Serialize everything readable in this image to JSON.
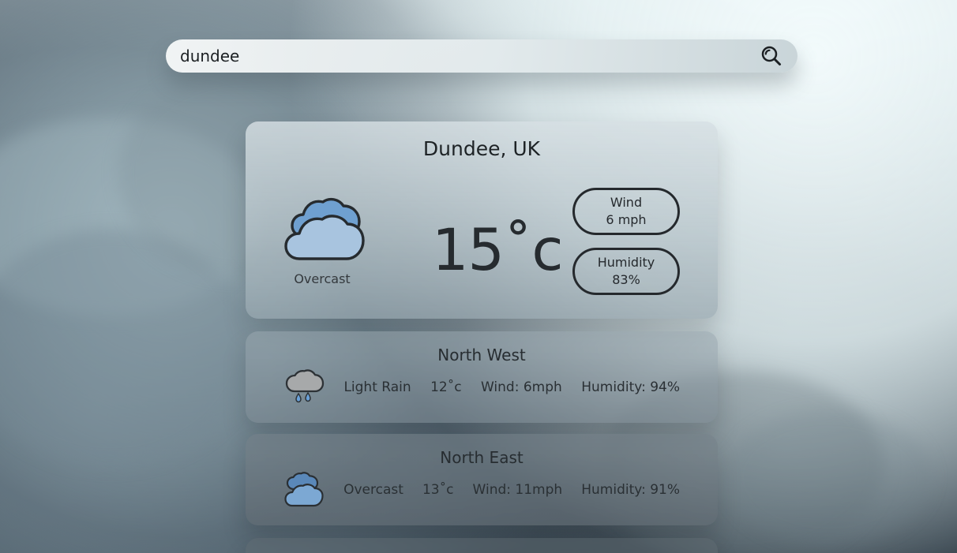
{
  "search": {
    "value": "dundee",
    "button_icon": "search-icon"
  },
  "current": {
    "city": "Dundee, UK",
    "condition": "Overcast",
    "temperature": "15˚c",
    "wind_label": "Wind",
    "wind_value": "6 mph",
    "humidity_label": "Humidity",
    "humidity_value": "83%",
    "icon": "overcast-icon"
  },
  "forecasts": [
    {
      "location": "North West",
      "condition": "Light Rain",
      "temperature": "12˚c",
      "wind": "Wind: 6mph",
      "humidity": "Humidity: 94%",
      "icon": "light-rain-icon"
    },
    {
      "location": "North East",
      "condition": "Overcast",
      "temperature": "13˚c",
      "wind": "Wind: 11mph",
      "humidity": "Humidity: 91%",
      "icon": "overcast-icon"
    }
  ],
  "colors": {
    "text_dark": "#25292d",
    "cloud_blue": "#9dbfdf",
    "cloud_blue_dark": "#6fa0d0"
  }
}
